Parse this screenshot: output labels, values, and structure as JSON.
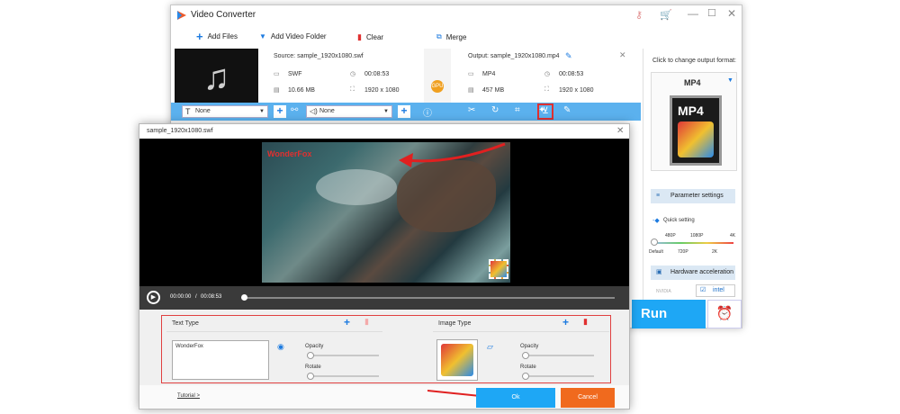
{
  "app": {
    "title": "Video Converter"
  },
  "toolbar": {
    "add_files": "Add Files",
    "add_folder": "Add Video Folder",
    "clear": "Clear",
    "merge": "Merge"
  },
  "source": {
    "label": "Source: sample_1920x1080.swf",
    "format": "SWF",
    "duration": "00:08:53",
    "size": "10.66 MB",
    "resolution": "1920 x 1080"
  },
  "output": {
    "label": "Output: sample_1920x1080.mp4",
    "format": "MP4",
    "duration": "00:08:53",
    "size": "457 MB",
    "resolution": "1920 x 1080"
  },
  "gpu_label": "GPU",
  "editbar": {
    "subtitle_value": "None",
    "audio_value": "None"
  },
  "side": {
    "hint": "Click to change output format:",
    "format": "MP4",
    "param_settings": "Parameter settings",
    "quick_setting": "Quick setting",
    "quality_top": [
      "480P",
      "1080P",
      "4K"
    ],
    "quality_bottom": [
      "Default",
      "720P",
      "2K"
    ],
    "hw_accel": "Hardware acceleration",
    "nvidia": "NVIDIA",
    "intel": "intel"
  },
  "run": "Run",
  "dialog": {
    "title": "sample_1920x1080.swf",
    "watermark": "WonderFox",
    "time_current": "00:00:00",
    "time_sep": "/",
    "time_total": "00:08:53",
    "text_type": "Text Type",
    "text_value": "WonderFox",
    "image_type": "Image Type",
    "opacity": "Opacity",
    "rotate": "Rotate",
    "tutorial": "Tutorial >",
    "ok": "Ok",
    "cancel": "Cancel"
  },
  "colors": {
    "accent": "#1ea7f5",
    "editbar": "#5bb1ee",
    "cancel": "#f06a1e",
    "highlight": "#e04040"
  }
}
